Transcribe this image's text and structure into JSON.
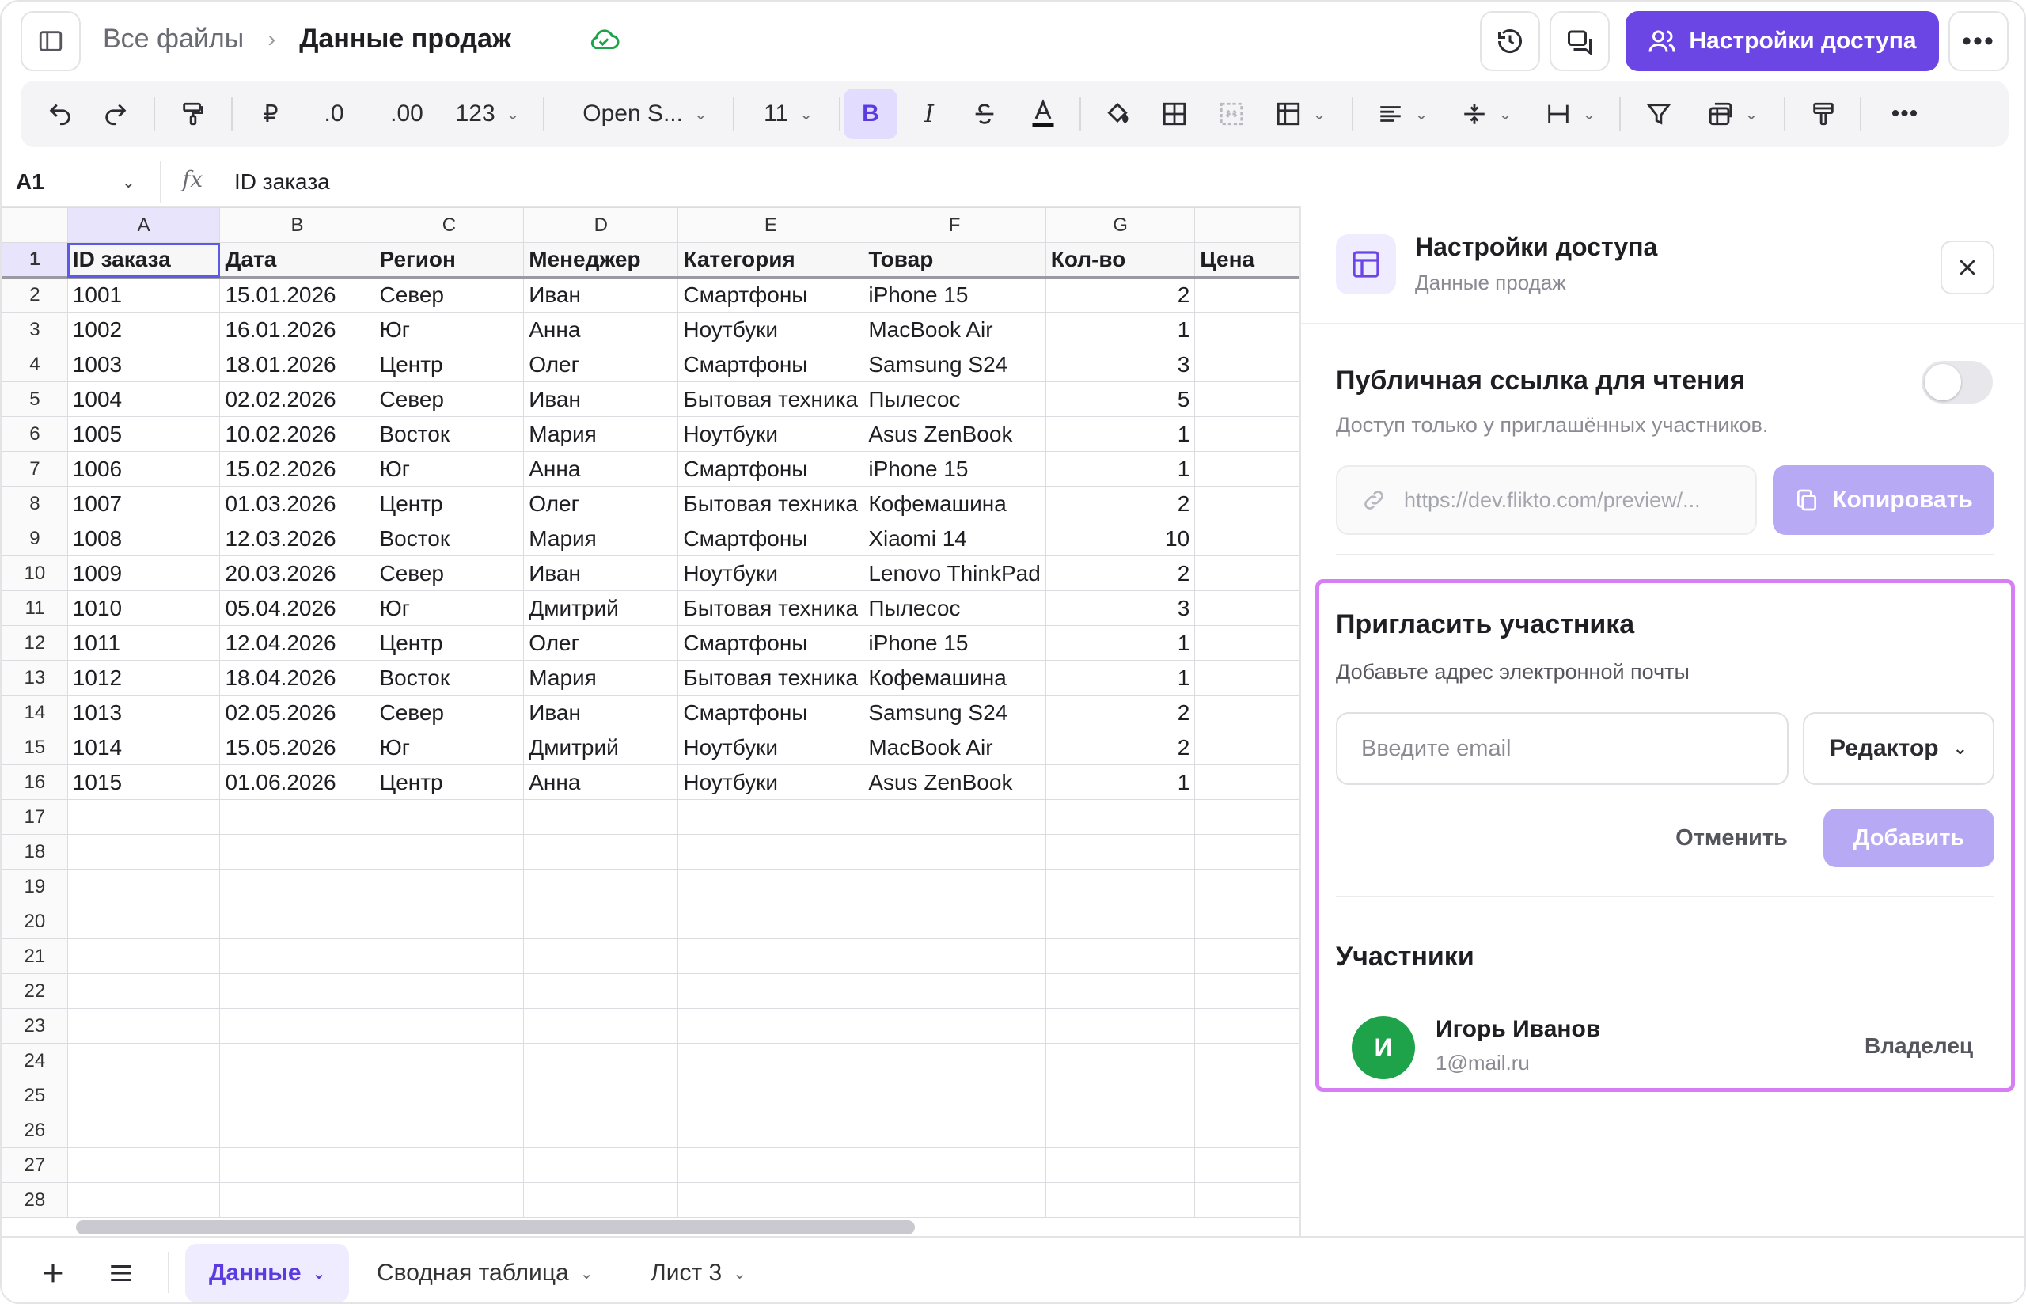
{
  "header": {
    "breadcrumb_root": "Все файлы",
    "breadcrumb_sep": "›",
    "file_name": "Данные продаж",
    "share_button": "Настройки доступа",
    "accent": "#6b46e5"
  },
  "toolbar": {
    "currency": "₽",
    "decimals_less": ".0",
    "decimals_more": ".00",
    "number_format": "123",
    "font_name": "Open S...",
    "font_size": "11",
    "bold": "B",
    "italic": "I",
    "icons": [
      "undo-icon",
      "redo-icon",
      "paint-format-icon",
      "fill-color-icon",
      "borders-icon",
      "merge-icon",
      "table-format-icon",
      "align-icon",
      "valign-icon",
      "wrap-icon",
      "filter-icon",
      "conditional-icon",
      "clear-format-icon",
      "more-icon"
    ]
  },
  "formula_bar": {
    "cell_ref": "A1",
    "fx": "fx",
    "value": "ID заказа"
  },
  "sheet": {
    "columns": [
      "A",
      "B",
      "C",
      "D",
      "E",
      "F",
      "G",
      ""
    ],
    "header_row": [
      "ID заказа",
      "Дата",
      "Регион",
      "Менеджер",
      "Категория",
      "Товар",
      "Кол-во",
      "Цена"
    ],
    "rows": [
      [
        "1001",
        "15.01.2026",
        "Север",
        "Иван",
        "Смартфоны",
        "iPhone 15",
        "2"
      ],
      [
        "1002",
        "16.01.2026",
        "Юг",
        "Анна",
        "Ноутбуки",
        "MacBook Air",
        "1"
      ],
      [
        "1003",
        "18.01.2026",
        "Центр",
        "Олег",
        "Смартфоны",
        "Samsung S24",
        "3"
      ],
      [
        "1004",
        "02.02.2026",
        "Север",
        "Иван",
        "Бытовая техника",
        "Пылесос",
        "5"
      ],
      [
        "1005",
        "10.02.2026",
        "Восток",
        "Мария",
        "Ноутбуки",
        "Asus ZenBook",
        "1"
      ],
      [
        "1006",
        "15.02.2026",
        "Юг",
        "Анна",
        "Смартфоны",
        "iPhone 15",
        "1"
      ],
      [
        "1007",
        "01.03.2026",
        "Центр",
        "Олег",
        "Бытовая техника",
        "Кофемашина",
        "2"
      ],
      [
        "1008",
        "12.03.2026",
        "Восток",
        "Мария",
        "Смартфоны",
        "Xiaomi 14",
        "10"
      ],
      [
        "1009",
        "20.03.2026",
        "Север",
        "Иван",
        "Ноутбуки",
        "Lenovo ThinkPad",
        "2"
      ],
      [
        "1010",
        "05.04.2026",
        "Юг",
        "Дмитрий",
        "Бытовая техника",
        "Пылесос",
        "3"
      ],
      [
        "1011",
        "12.04.2026",
        "Центр",
        "Олег",
        "Смартфоны",
        "iPhone 15",
        "1"
      ],
      [
        "1012",
        "18.04.2026",
        "Восток",
        "Мария",
        "Бытовая техника",
        "Кофемашина",
        "1"
      ],
      [
        "1013",
        "02.05.2026",
        "Север",
        "Иван",
        "Смартфоны",
        "Samsung S24",
        "2"
      ],
      [
        "1014",
        "15.05.2026",
        "Юг",
        "Дмитрий",
        "Ноутбуки",
        "MacBook Air",
        "2"
      ],
      [
        "1015",
        "01.06.2026",
        "Центр",
        "Анна",
        "Ноутбуки",
        "Asus ZenBook",
        "1"
      ]
    ],
    "row_numbers": [
      "1",
      "2",
      "3",
      "4",
      "5",
      "6",
      "7",
      "8",
      "9",
      "10",
      "11",
      "12",
      "13",
      "14",
      "15",
      "16",
      "17",
      "18",
      "19",
      "20",
      "21",
      "22",
      "23",
      "24",
      "25",
      "26",
      "27",
      "28"
    ]
  },
  "tabs": [
    {
      "label": "Данные"
    },
    {
      "label": "Сводная таблица"
    },
    {
      "label": "Лист 3"
    }
  ],
  "panel": {
    "title": "Настройки доступа",
    "subtitle": "Данные продаж",
    "public_link_title": "Публичная ссылка для чтения",
    "public_link_desc": "Доступ только у приглашённых участников.",
    "link_url": "https://dev.flikto.com/preview/...",
    "copy_button": "Копировать",
    "public_enabled": false,
    "invite_title": "Пригласить участника",
    "invite_label": "Добавьте адрес электронной почты",
    "email_placeholder": "Введите email",
    "email_value": "",
    "role_selected": "Редактор",
    "cancel_button": "Отменить",
    "add_button": "Добавить",
    "members_title": "Участники",
    "members": [
      {
        "initial": "И",
        "name": "Игорь Иванов",
        "email": "1@mail.ru",
        "role": "Владелец",
        "color": "#1fa34a"
      }
    ]
  }
}
